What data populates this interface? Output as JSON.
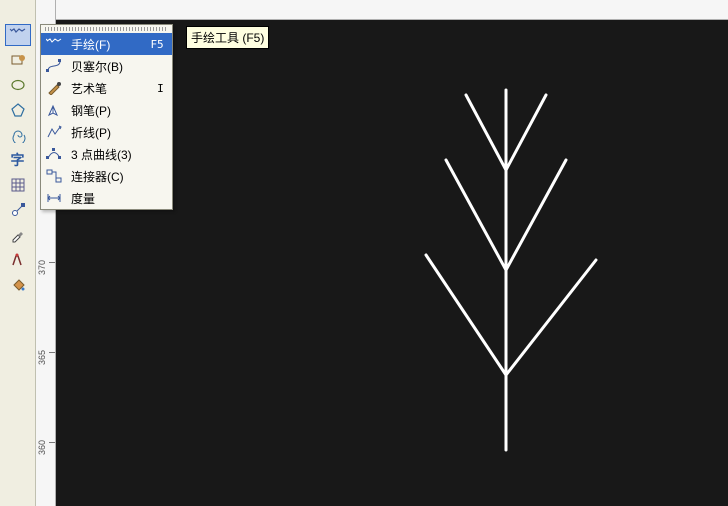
{
  "tooltip": "手绘工具 (F5)",
  "flyout": {
    "items": [
      {
        "label": "手绘(F)",
        "shortcut": "F5",
        "icon": "freehand",
        "selected": true
      },
      {
        "label": "贝塞尔(B)",
        "shortcut": "",
        "icon": "bezier",
        "selected": false
      },
      {
        "label": "艺术笔",
        "shortcut": "I",
        "icon": "artistic",
        "selected": false
      },
      {
        "label": "钢笔(P)",
        "shortcut": "",
        "icon": "pen",
        "selected": false
      },
      {
        "label": "折线(P)",
        "shortcut": "",
        "icon": "polyline",
        "selected": false
      },
      {
        "label": "3 点曲线(3)",
        "shortcut": "",
        "icon": "3pt",
        "selected": false
      },
      {
        "label": "连接器(C)",
        "shortcut": "",
        "icon": "connector",
        "selected": false
      },
      {
        "label": "度量",
        "shortcut": "",
        "icon": "dimension",
        "selected": false
      }
    ]
  },
  "ruler": {
    "labels": [
      "370",
      "365",
      "360"
    ]
  },
  "toolbox": [
    "freehand-active",
    "shape",
    "ellipse",
    "polygon",
    "spiral",
    "text",
    "grid",
    "eyedrop",
    "paintbucket",
    "outline",
    "fill"
  ]
}
